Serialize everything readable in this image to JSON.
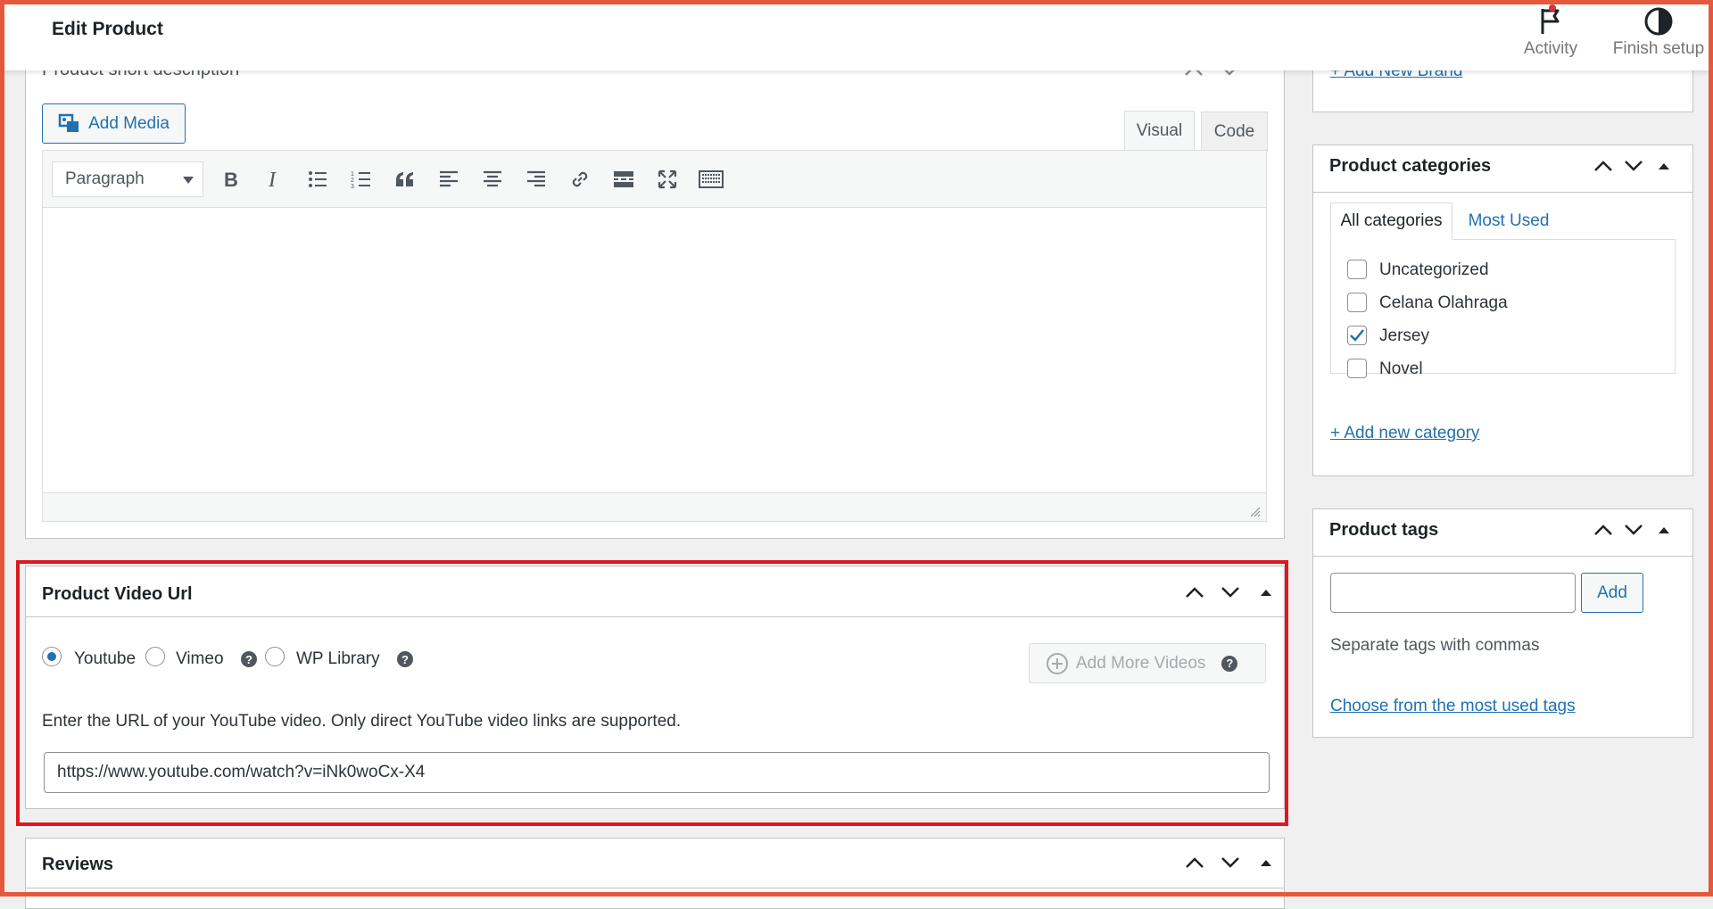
{
  "header": {
    "title": "Edit Product",
    "activity_label": "Activity",
    "finish_setup_label": "Finish setup"
  },
  "short_description": {
    "title": "Product short description",
    "add_media_label": "Add Media",
    "tab_visual": "Visual",
    "tab_code": "Code",
    "format_select": "Paragraph"
  },
  "video_box": {
    "title": "Product Video Url",
    "options": [
      "Youtube",
      "Vimeo",
      "WP Library"
    ],
    "selected": "Youtube",
    "add_more_label": "Add More Videos",
    "instructions": "Enter the URL of your YouTube video. Only direct YouTube video links are supported.",
    "url_value": "https://www.youtube.com/watch?v=iNk0woCx-X4"
  },
  "reviews_box": {
    "title": "Reviews"
  },
  "brands_box": {
    "add_link": "+ Add New Brand"
  },
  "categories_box": {
    "title": "Product categories",
    "tab_all": "All categories",
    "tab_most_used": "Most Used",
    "items": [
      {
        "label": "Uncategorized",
        "checked": false
      },
      {
        "label": "Celana Olahraga",
        "checked": false
      },
      {
        "label": "Jersey",
        "checked": true
      },
      {
        "label": "Novel",
        "checked": false
      }
    ],
    "add_link": "+ Add new category"
  },
  "tags_box": {
    "title": "Product tags",
    "input_value": "",
    "add_label": "Add",
    "hint": "Separate tags with commas",
    "choose_link": "Choose from the most used tags"
  },
  "colors": {
    "accent": "#2271b1",
    "highlight": "#e0171f",
    "frame": "#e4593d"
  }
}
